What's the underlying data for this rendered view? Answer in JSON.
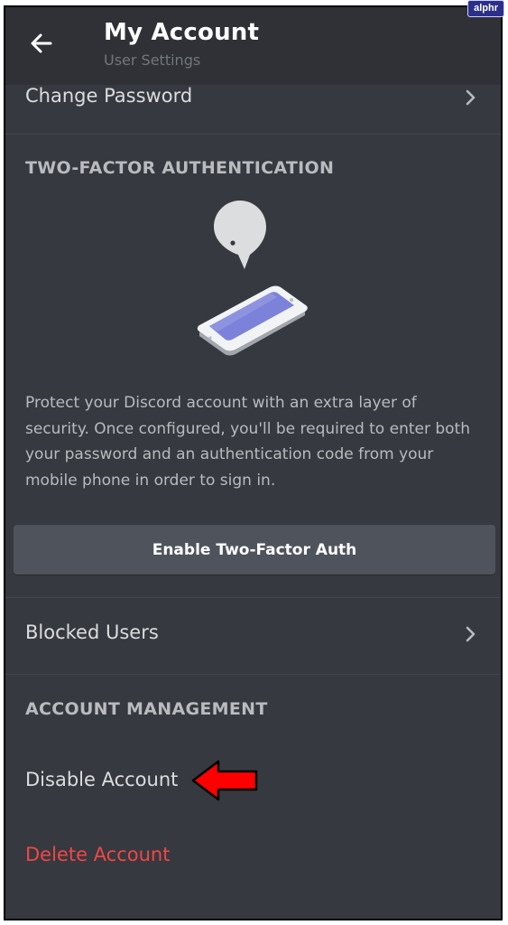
{
  "header": {
    "title": "My Account",
    "subtitle": "User Settings"
  },
  "rows": {
    "change_password": "Change Password",
    "blocked_users": "Blocked Users",
    "disable_account": "Disable Account",
    "delete_account": "Delete Account"
  },
  "two_factor": {
    "section_title": "TWO-FACTOR AUTHENTICATION",
    "description": "Protect your Discord account with an extra layer of security. Once configured, you'll be required to enter both your password and an authentication code from your mobile phone in order to sign in.",
    "button_label": "Enable Two-Factor Auth"
  },
  "account_management": {
    "section_title": "ACCOUNT MANAGEMENT"
  },
  "watermark": "alphr",
  "icons": {
    "back": "back-arrow-icon",
    "chevron": "chevron-right-icon",
    "illustration": "phone-chat-illustration",
    "annotation": "red-arrow-annotation"
  },
  "colors": {
    "background": "#36393f",
    "header": "#2f3136",
    "button": "#4f545c",
    "danger": "#f04747",
    "annotation": "#ff0000"
  }
}
